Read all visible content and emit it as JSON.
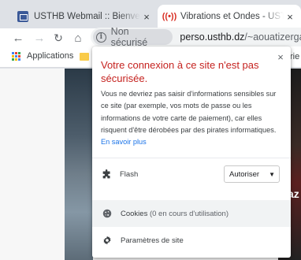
{
  "tabs": [
    {
      "title": "USTHB Webmail :: Bienvenue à USTHB",
      "favicon": "webmail-icon",
      "active": false,
      "close": "×"
    },
    {
      "title": "Vibrations et Ondes - USTHB - Cours",
      "favicon": "audio-playing-icon",
      "active": true,
      "close": "×"
    }
  ],
  "toolbar": {
    "back": "←",
    "forward": "→",
    "reload": "↻",
    "home": "⌂",
    "security_chip": "Non sécurisé",
    "url_host": "perso.usthb.dz",
    "url_path": "/~aouatizerga/"
  },
  "bookmarks": {
    "apps_label": "Applications",
    "overflow_text": "rie"
  },
  "page": {
    "visible_text": "az"
  },
  "popup": {
    "close": "×",
    "title": "Votre connexion à ce site n'est pas sécurisée.",
    "body": "Vous ne devriez pas saisir d'informations sensibles sur ce site (par exemple, vos mots de passe ou les informations de votre carte de paiement), car elles risquent d'être dérobées par des pirates informatiques.",
    "learn_more": "En savoir plus",
    "flash_label": "Flash",
    "flash_value": "Autoriser",
    "cookies_label": "Cookies",
    "cookies_sub": "(0 en cours d'utilisation)",
    "site_settings_label": "Paramètres de site"
  },
  "colors": {
    "warning_title": "#c5221f",
    "link": "#1a73e8",
    "chip_bg": "#dadce0"
  }
}
